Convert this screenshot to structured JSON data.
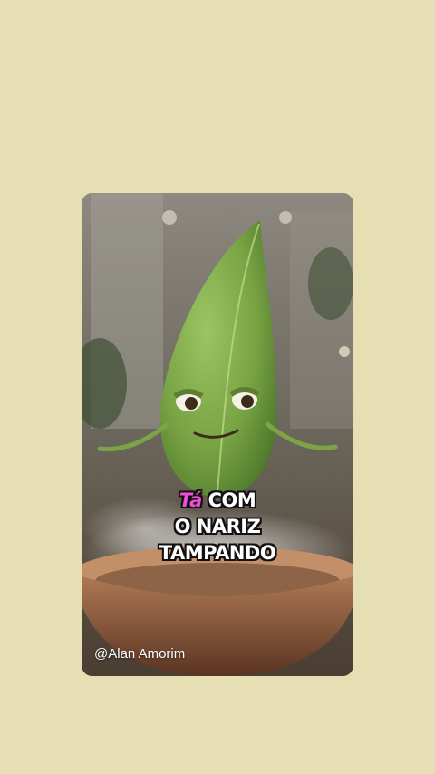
{
  "page": {
    "background_color": "#e6dfb3"
  },
  "video": {
    "caption": {
      "highlight_word": "Tá",
      "highlight_color": "#ee4fd6",
      "line1_rest": "COM",
      "line2": "O NARIZ",
      "line3": "TAMPANDO"
    },
    "credit": "@Alan Amorim"
  }
}
